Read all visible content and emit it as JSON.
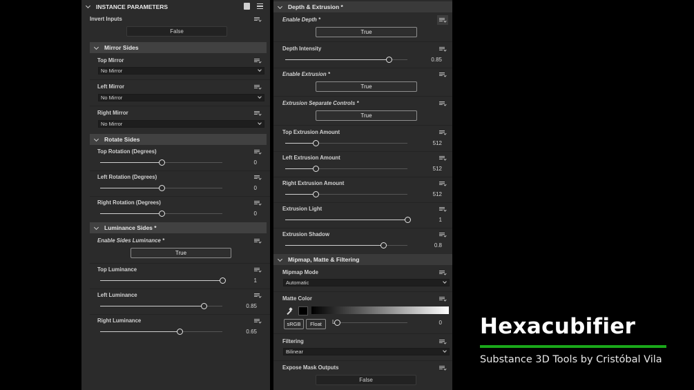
{
  "left_panel": {
    "title": "INSTANCE PARAMETERS",
    "invert_inputs": {
      "label": "Invert Inputs",
      "value": "False"
    },
    "mirror_sides": {
      "title": "Mirror Sides",
      "top": {
        "label": "Top Mirror",
        "value": "No Mirror"
      },
      "left": {
        "label": "Left Mirror",
        "value": "No Mirror"
      },
      "right": {
        "label": "Right Mirror",
        "value": "No Mirror"
      }
    },
    "rotate_sides": {
      "title": "Rotate Sides",
      "top": {
        "label": "Top Rotation (Degrees)",
        "value": "0",
        "fraction": 0.5
      },
      "left": {
        "label": "Left Rotation (Degrees)",
        "value": "0",
        "fraction": 0.5
      },
      "right": {
        "label": "Right Rotation (Degrees)",
        "value": "0",
        "fraction": 0.5
      }
    },
    "luminance_sides": {
      "title": "Luminance Sides *",
      "enable": {
        "label": "Enable Sides Luminance *",
        "value": "True"
      },
      "top": {
        "label": "Top Luminance",
        "value": "1",
        "fraction": 1.0
      },
      "left": {
        "label": "Left Luminance",
        "value": "0.85",
        "fraction": 0.85
      },
      "right": {
        "label": "Right Luminance",
        "value": "0.65",
        "fraction": 0.65
      }
    }
  },
  "right_panel": {
    "depth_extrusion": {
      "title": "Depth & Extrusion *",
      "enable_depth": {
        "label": "Enable Depth *",
        "value": "True"
      },
      "depth_intensity": {
        "label": "Depth Intensity",
        "value": "0.85",
        "fraction": 0.85
      },
      "enable_extrusion": {
        "label": "Enable Extrusion *",
        "value": "True"
      },
      "separate_controls": {
        "label": "Extrusion Separate Controls *",
        "value": "True"
      },
      "top_amount": {
        "label": "Top Extrusion Amount",
        "value": "512",
        "fraction": 0.25
      },
      "left_amount": {
        "label": "Left Extrusion Amount",
        "value": "512",
        "fraction": 0.25
      },
      "right_amount": {
        "label": "Right Extrusion Amount",
        "value": "512",
        "fraction": 0.25
      },
      "light": {
        "label": "Extrusion Light",
        "value": "1",
        "fraction": 1.0
      },
      "shadow": {
        "label": "Extrusion Shadow",
        "value": "0.8",
        "fraction": 0.8
      }
    },
    "mipmap": {
      "title": "Mipmap, Matte & Filtering",
      "mode": {
        "label": "Mipmap Mode",
        "value": "Automatic"
      },
      "matte": {
        "label": "Matte Color",
        "srgb": "sRGB",
        "float": "Float",
        "channel": "L",
        "value": "0",
        "fraction": 0.0,
        "swatch": "#000000"
      },
      "filtering": {
        "label": "Filtering",
        "value": "Bilinear"
      },
      "expose": {
        "label": "Expose Mask Outputs",
        "value": "False"
      }
    }
  },
  "branding": {
    "title": "Hexacubifier",
    "subtitle": "Substance 3D Tools by Cristóbal Vila",
    "accent": "#1aa81a"
  }
}
